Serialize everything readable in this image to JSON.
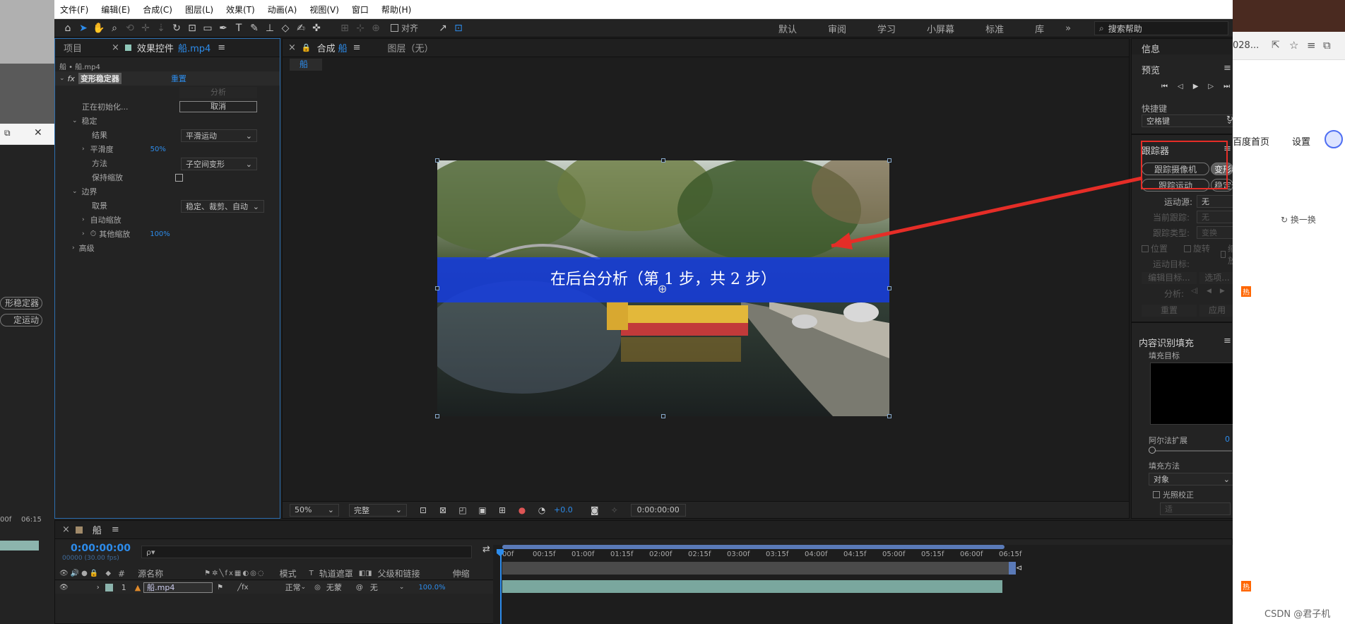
{
  "left_bg": {
    "tabs_frag": [
      "⧉",
      "✕"
    ],
    "items": [
      "形稳定器",
      "定运动"
    ],
    "time_frag": "00f",
    "time2": "06:15"
  },
  "menu": [
    "文件(F)",
    "编辑(E)",
    "合成(C)",
    "图层(L)",
    "效果(T)",
    "动画(A)",
    "视图(V)",
    "窗口",
    "帮助(H)"
  ],
  "toolbar": {
    "align_label": "对齐",
    "workspaces": [
      "默认",
      "审阅",
      "学习",
      "小屏幕",
      "标准",
      "库"
    ],
    "search_placeholder": "搜索帮助"
  },
  "effect_panel": {
    "tab_project": "项目",
    "tab_effects": "效果控件",
    "tab_effects_file": "船.mp4",
    "breadcrumb": "船 • 船.mp4",
    "fx_name": "变形稳定器",
    "reset": "重置",
    "analyze": "分析",
    "status": "正在初始化...",
    "cancel": "取消",
    "stabilize": "稳定",
    "result_label": "结果",
    "result_value": "平滑运动",
    "smoothness_label": "平滑度",
    "smoothness_value": "50%",
    "method_label": "方法",
    "method_value": "子空间变形",
    "keep_scale_label": "保持缩放",
    "borders": "边界",
    "framing_label": "取景",
    "framing_value": "稳定、裁剪、自动",
    "auto_scale": "自动缩放",
    "other_scale_label": "其他缩放",
    "other_scale_value": "100%",
    "advanced": "高级"
  },
  "comp_panel": {
    "tab_comp": "合成",
    "tab_comp_name": "船",
    "tab_layer": "图层（无）",
    "subtab": "船",
    "banner": "在后台分析（第 1 步，共 2 步）",
    "zoom": "50%",
    "quality": "完整",
    "exposure": "+0.0",
    "timecode": "0:00:00:00"
  },
  "right_panel": {
    "info": "信息",
    "preview": "预览",
    "shortcut": "快捷键",
    "shortcut_value": "空格键",
    "tracker": "跟踪器",
    "track_camera": "跟踪摄像机",
    "warp_stabilizer": "变形稳定器",
    "track_motion": "跟踪运动",
    "stabilize_motion": "稳定运动",
    "motion_source": "运动源:",
    "motion_source_value": "无",
    "current_track": "当前跟踪:",
    "current_track_value": "无",
    "track_type": "跟踪类型:",
    "track_type_value": "变换",
    "position": "位置",
    "rotation": "旋转",
    "scale": "缩放",
    "motion_target": "运动目标:",
    "edit_target": "编辑目标...",
    "options": "选项...",
    "analyze": "分析:",
    "reset": "重置",
    "apply": "应用",
    "content_fill": "内容识别填充",
    "fill_target": "填充目标",
    "alpha_expand": "阿尔法扩展",
    "alpha_value": "0",
    "fill_method": "填充方法",
    "fill_method_value": "对象",
    "light_correct": "光照校正",
    "range_value": "适"
  },
  "timeline": {
    "comp_name": "船",
    "timecode": "0:00:00:00",
    "fps": "00000 (30.00 fps)",
    "search_icon": "ρ▾",
    "col_source": "源名称",
    "col_mode": "模式",
    "col_t": "T",
    "col_track": "轨道遮罩",
    "col_parent": "父级和链接",
    "col_stretch": "伸缩",
    "col_hash": "#",
    "layer_index": "1",
    "layer_name": "船.mp4",
    "layer_mode": "正常",
    "layer_track": "无蒙",
    "layer_parent": "无",
    "layer_stretch": "100.0%",
    "ruler": [
      "00f",
      "00:15f",
      "01:00f",
      "01:15f",
      "02:00f",
      "02:15f",
      "03:00f",
      "03:15f",
      "04:00f",
      "04:15f",
      "05:00f",
      "05:15f",
      "06:00f",
      "06:15f"
    ]
  },
  "browser_bg": {
    "url_frag": "028...",
    "baidu": "百度首页",
    "settings": "设置",
    "refresh": "换一换",
    "hot": "热",
    "watermark": "CSDN @君子机"
  }
}
